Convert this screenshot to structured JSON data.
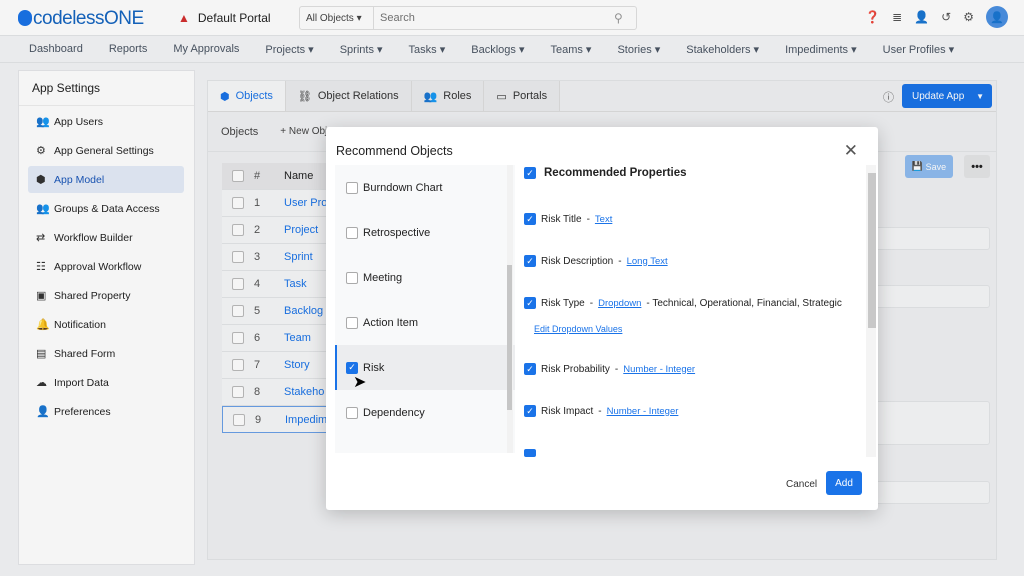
{
  "header": {
    "logo": "codelessONE",
    "portal": "Default Portal",
    "search_scope": "All Objects",
    "search_placeholder": "Search",
    "icons": [
      "help-icon",
      "database-icon",
      "add-user-icon",
      "history-icon",
      "gear-icon",
      "avatar"
    ]
  },
  "nav": [
    "Dashboard",
    "Reports",
    "My Approvals",
    "Projects ▾",
    "Sprints ▾",
    "Tasks ▾",
    "Backlogs ▾",
    "Teams ▾",
    "Stories ▾",
    "Stakeholders ▾",
    "Impediments ▾",
    "User Profiles ▾"
  ],
  "sidebar": {
    "title": "App Settings",
    "items": [
      {
        "label": "App Users",
        "icon": "users-icon",
        "g": "👥"
      },
      {
        "label": "App General Settings",
        "icon": "gear-icon",
        "g": "⚙"
      },
      {
        "label": "App Model",
        "icon": "cube-icon",
        "g": "⬢",
        "active": true
      },
      {
        "label": "Groups & Data Access",
        "icon": "group-icon",
        "g": "👥"
      },
      {
        "label": "Workflow Builder",
        "icon": "arrows-icon",
        "g": "⇄"
      },
      {
        "label": "Approval Workflow",
        "icon": "checklist-icon",
        "g": "☷"
      },
      {
        "label": "Shared Property",
        "icon": "inbox-icon",
        "g": "▣"
      },
      {
        "label": "Notification",
        "icon": "bell-icon",
        "g": "🔔"
      },
      {
        "label": "Shared Form",
        "icon": "form-icon",
        "g": "▤"
      },
      {
        "label": "Import Data",
        "icon": "cloud-upload-icon",
        "g": "☁"
      },
      {
        "label": "Preferences",
        "icon": "user-settings-icon",
        "g": "👤"
      }
    ]
  },
  "tabs": [
    {
      "label": "Objects",
      "g": "⬢"
    },
    {
      "label": "Object Relations",
      "g": "⛓"
    },
    {
      "label": "Roles",
      "g": "👥"
    },
    {
      "label": "Portals",
      "g": "▭"
    }
  ],
  "update_app": "Update App",
  "toolbar": {
    "objects": "Objects",
    "new_object": "+ New Obj",
    "save": "Save",
    "more": "•••"
  },
  "table": {
    "headers": [
      "#",
      "Name"
    ],
    "rows": [
      [
        "1",
        "User Pro"
      ],
      [
        "2",
        "Project"
      ],
      [
        "3",
        "Sprint"
      ],
      [
        "4",
        "Task"
      ],
      [
        "5",
        "Backlog"
      ],
      [
        "6",
        "Team"
      ],
      [
        "7",
        "Story"
      ],
      [
        "8",
        "Stakeho"
      ],
      [
        "9",
        "Impedim"
      ]
    ]
  },
  "modal": {
    "title": "Recommend Objects",
    "objects": [
      {
        "label": "Burndown Chart",
        "checked": false
      },
      {
        "label": "Retrospective",
        "checked": false
      },
      {
        "label": "Meeting",
        "checked": false
      },
      {
        "label": "Action Item",
        "checked": false
      },
      {
        "label": "Risk",
        "checked": true
      },
      {
        "label": "Dependency",
        "checked": false
      }
    ],
    "props_title": "Recommended Properties",
    "properties": [
      {
        "name": "Risk Title",
        "type": "Text"
      },
      {
        "name": "Risk Description",
        "type": "Long Text"
      },
      {
        "name": "Risk Type",
        "type": "Dropdown",
        "values": "- Technical, Operational, Financial, Strategic",
        "edit": "Edit Dropdown Values"
      },
      {
        "name": "Risk Probability",
        "type": "Number - Integer"
      },
      {
        "name": "Risk Impact",
        "type": "Number - Integer"
      }
    ],
    "cancel": "Cancel",
    "add": "Add"
  },
  "accent": "#1a73e8"
}
